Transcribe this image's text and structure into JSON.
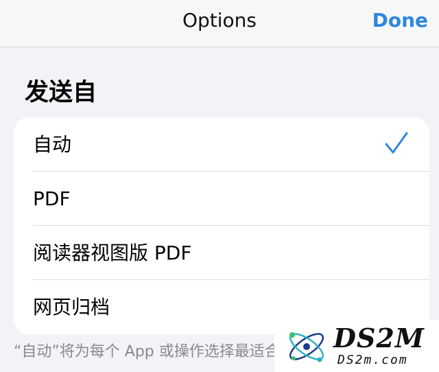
{
  "nav": {
    "title": "Options",
    "done_label": "Done"
  },
  "section": {
    "header": "发送自"
  },
  "options": [
    {
      "label": "自动",
      "selected": true
    },
    {
      "label": "PDF",
      "selected": false
    },
    {
      "label": "阅读器视图版 PDF",
      "selected": false
    },
    {
      "label": "网页归档",
      "selected": false
    }
  ],
  "footer": {
    "text": "“自动”将为每个 App 或操作选择最适合"
  },
  "watermark": {
    "brand": "DS2M",
    "url": "DS2m.com"
  },
  "colors": {
    "accent": "#2f86de",
    "background": "#f2f2f7",
    "card": "#ffffff",
    "footer_text": "#8a8a8e"
  },
  "icons": {
    "selected_marker": "checkmark-icon"
  }
}
